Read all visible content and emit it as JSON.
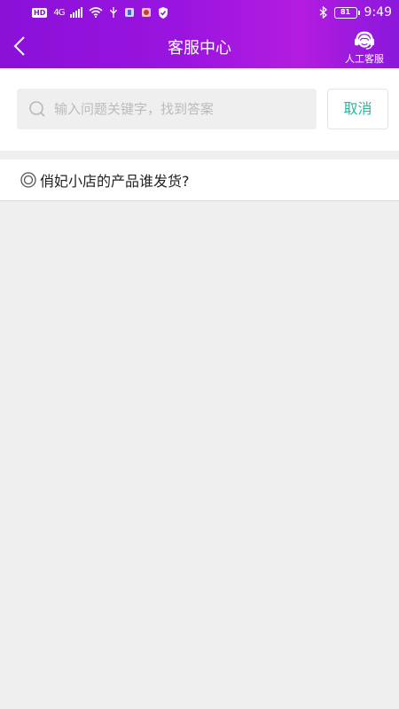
{
  "status_bar": {
    "network": "HD",
    "signal": "4G",
    "battery": "81",
    "time": "9:49"
  },
  "header": {
    "title": "客服中心",
    "agent_label": "人工客服",
    "back_icon": "chevron-left-icon",
    "agent_icon": "headset-icon"
  },
  "search": {
    "placeholder": "输入问题关键字，找到答案",
    "value": "",
    "cancel_label": "取消"
  },
  "results": [
    {
      "text": "俏妃小店的产品谁发货?"
    }
  ],
  "colors": {
    "header_gradient_start": "#8a10d8",
    "header_gradient_end": "#b31ce0",
    "accent": "#22b7a0",
    "page_background": "#efefef"
  }
}
